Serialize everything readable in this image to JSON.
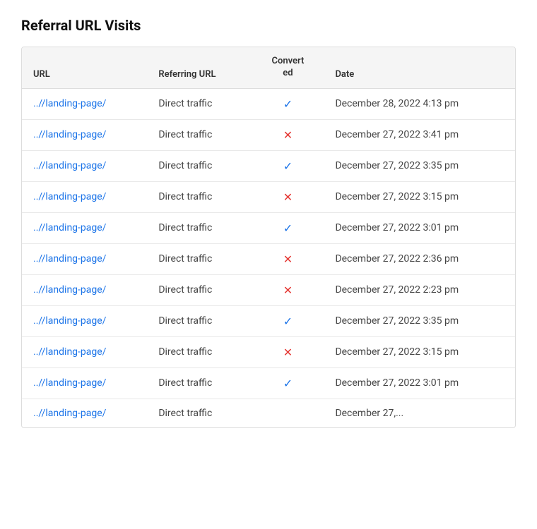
{
  "page": {
    "title": "Referral URL Visits"
  },
  "table": {
    "columns": [
      {
        "key": "url",
        "label": "URL"
      },
      {
        "key": "referring_url",
        "label": "Referring URL"
      },
      {
        "key": "converted",
        "label": "Converted"
      },
      {
        "key": "date",
        "label": "Date"
      }
    ],
    "rows": [
      {
        "url": "..//landing-page/",
        "referring_url": "Direct traffic",
        "converted": true,
        "date": "December 28, 2022 4:13 pm"
      },
      {
        "url": "..//landing-page/",
        "referring_url": "Direct traffic",
        "converted": false,
        "date": "December 27, 2022 3:41 pm"
      },
      {
        "url": "..//landing-page/",
        "referring_url": "Direct traffic",
        "converted": true,
        "date": "December 27, 2022 3:35 pm"
      },
      {
        "url": "..//landing-page/",
        "referring_url": "Direct traffic",
        "converted": false,
        "date": "December 27, 2022 3:15 pm"
      },
      {
        "url": "..//landing-page/",
        "referring_url": "Direct traffic",
        "converted": true,
        "date": "December 27, 2022 3:01 pm"
      },
      {
        "url": "..//landing-page/",
        "referring_url": "Direct traffic",
        "converted": false,
        "date": "December 27, 2022 2:36 pm"
      },
      {
        "url": "..//landing-page/",
        "referring_url": "Direct traffic",
        "converted": false,
        "date": "December 27, 2022 2:23 pm"
      },
      {
        "url": "..//landing-page/",
        "referring_url": "Direct traffic",
        "converted": true,
        "date": "December 27, 2022 3:35 pm"
      },
      {
        "url": "..//landing-page/",
        "referring_url": "Direct traffic",
        "converted": false,
        "date": "December 27, 2022 3:15 pm"
      },
      {
        "url": "..//landing-page/",
        "referring_url": "Direct traffic",
        "converted": true,
        "date": "December 27, 2022 3:01 pm"
      },
      {
        "url": "..//landing-page/",
        "referring_url": "Direct traffic",
        "converted": null,
        "date": "December 27,..."
      }
    ]
  }
}
